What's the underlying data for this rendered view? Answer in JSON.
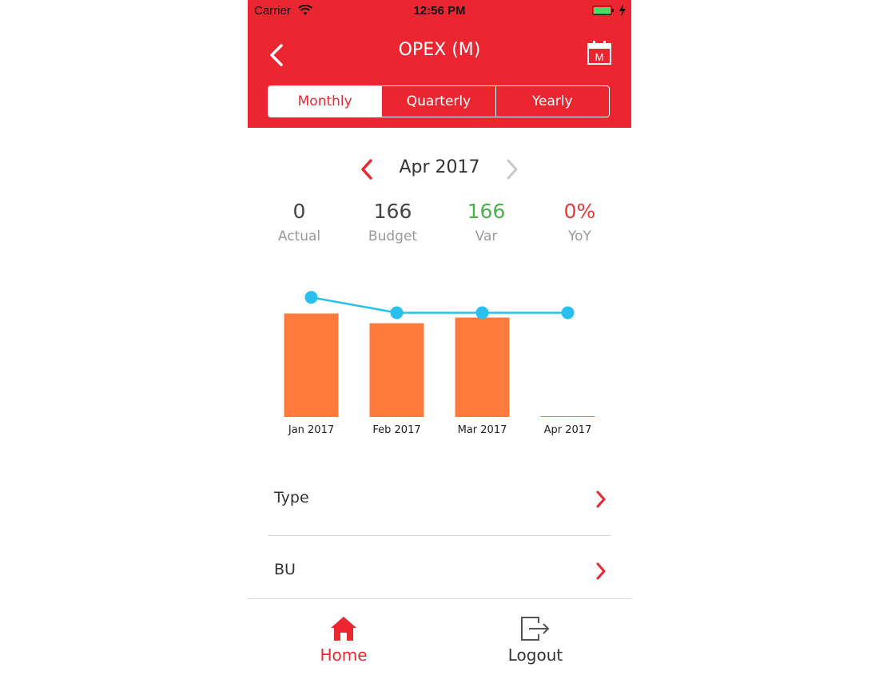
{
  "status_bar": {
    "carrier": "Carrier",
    "time": "12:56 PM"
  },
  "header": {
    "title": "OPEX (M)",
    "calendar_letter": "M",
    "tabs": [
      {
        "label": "Monthly",
        "active": true
      },
      {
        "label": "Quarterly",
        "active": false
      },
      {
        "label": "Yearly",
        "active": false
      }
    ]
  },
  "period": {
    "label": "Apr 2017"
  },
  "stats": {
    "actual": {
      "value": "0",
      "label": "Actual"
    },
    "budget": {
      "value": "166",
      "label": "Budget"
    },
    "var": {
      "value": "166",
      "label": "Var"
    },
    "yoy": {
      "value": "0%",
      "label": "YoY"
    }
  },
  "chart_data": {
    "type": "bar",
    "categories": [
      "Jan 2017",
      "Feb 2017",
      "Mar 2017",
      "Apr 2017"
    ],
    "series": [
      {
        "type": "bar",
        "values": [
          128,
          116,
          123,
          0
        ]
      },
      {
        "type": "line",
        "values": [
          148,
          129,
          129,
          129
        ]
      }
    ],
    "ylim": [
      0,
      170
    ],
    "grid": false
  },
  "list": [
    {
      "label": "Type"
    },
    {
      "label": "BU"
    }
  ],
  "tabbar": {
    "home": "Home",
    "logout": "Logout"
  },
  "colors": {
    "brand": "#ec2631",
    "bar": "#ff7a3d",
    "line": "#29c0f0",
    "positive": "#4caf50",
    "negative": "#e53935"
  },
  "icons": {
    "back": "chevron-left-icon",
    "calendar": "calendar-icon",
    "home": "home-icon",
    "logout": "logout-icon"
  }
}
